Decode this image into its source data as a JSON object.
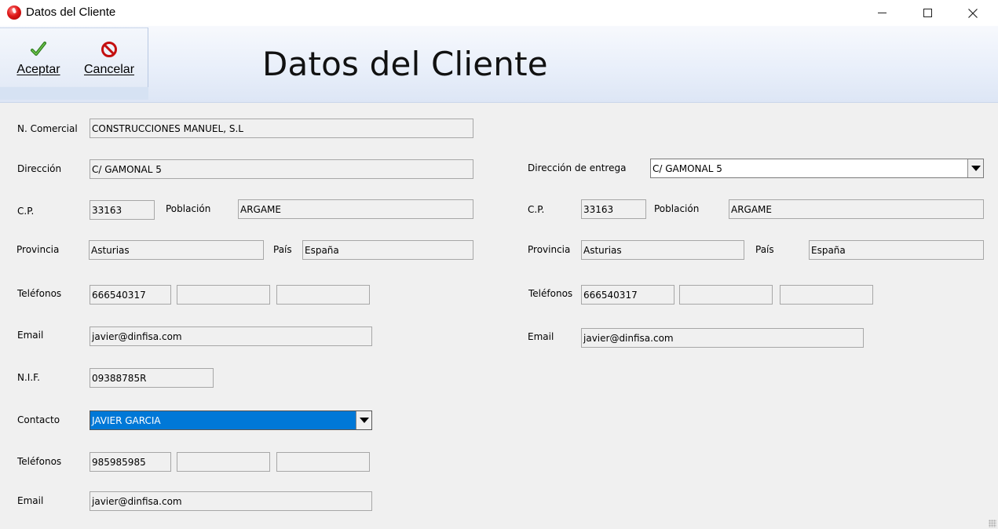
{
  "window": {
    "title": "Datos del Cliente",
    "icon": "app-icon"
  },
  "toolbar": {
    "accept_label": "Aceptar",
    "cancel_label": "Cancelar",
    "accept_icon": "checkmark-icon",
    "cancel_icon": "no-entry-icon"
  },
  "header": {
    "title": "Datos del Cliente"
  },
  "cliente": {
    "labels": {
      "nombre_comercial": "N. Comercial",
      "direccion": "Dirección",
      "cp": "C.P.",
      "poblacion": "Población",
      "provincia": "Provincia",
      "pais": "País",
      "telefonos": "Teléfonos",
      "email": "Email",
      "nif": "N.I.F."
    },
    "nombre_comercial": "CONSTRUCCIONES MANUEL, S.L",
    "direccion": "C/ GAMONAL 5",
    "cp": "33163",
    "poblacion": "ARGAME",
    "provincia": "Asturias",
    "pais": "España",
    "telefonos": [
      "666540317",
      "",
      ""
    ],
    "email": "javier@dinfisa.com",
    "nif": "09388785R"
  },
  "contacto": {
    "labels": {
      "contacto": "Contacto",
      "telefonos": "Teléfonos",
      "email": "Email"
    },
    "nombre": "JAVIER GARCIA",
    "telefonos": [
      "985985985",
      "",
      ""
    ],
    "email": "javier@dinfisa.com"
  },
  "entrega": {
    "labels": {
      "direccion": "Dirección de entrega",
      "cp": "C.P.",
      "poblacion": "Población",
      "provincia": "Provincia",
      "pais": "País",
      "telefonos": "Teléfonos",
      "email": "Email"
    },
    "direccion": "C/ GAMONAL 5",
    "cp": "33163",
    "poblacion": "ARGAME",
    "provincia": "Asturias",
    "pais": "España",
    "telefonos": [
      "666540317",
      "",
      ""
    ],
    "email": "javier@dinfisa.com"
  },
  "colors": {
    "selection": "#0078d7",
    "header_gradient_top": "#f7f9fd",
    "header_gradient_bottom": "#dde6f5"
  }
}
